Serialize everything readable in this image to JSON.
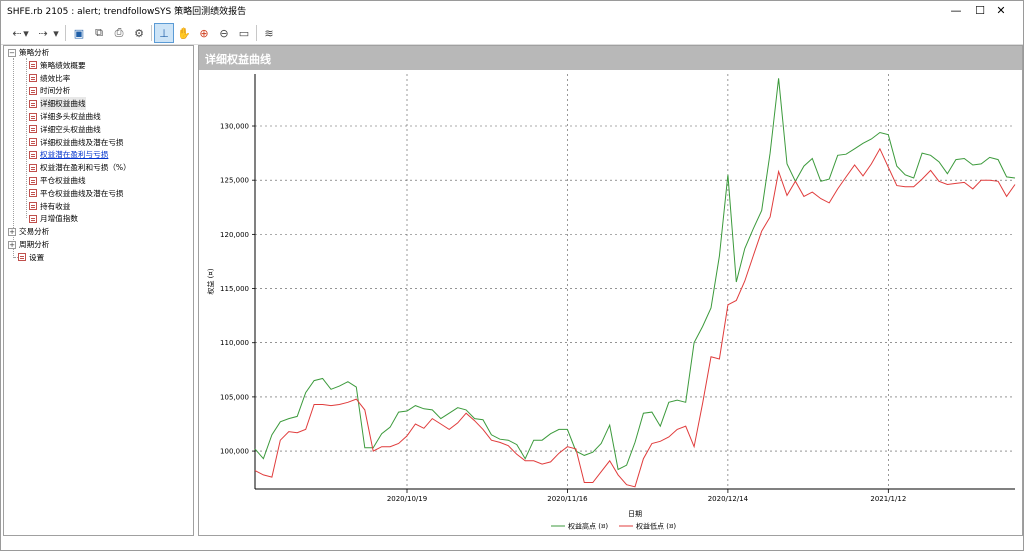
{
  "window": {
    "title": "SHFE.rb 2105 : alert; trendfollowSYS 策略回测绩效报告",
    "minimize": "—",
    "maximize": "☐",
    "close": "✕"
  },
  "toolbar": {
    "items": [
      {
        "name": "back-icon",
        "glyph": "⇠"
      },
      {
        "name": "dropdown-icon",
        "glyph": "▾"
      },
      {
        "name": "forward-icon",
        "glyph": "⇢"
      },
      {
        "name": "dropdown-icon",
        "glyph": "▾"
      },
      {
        "name": "save-icon",
        "glyph": "▣"
      },
      {
        "name": "copy-icon",
        "glyph": "⧉"
      },
      {
        "name": "print-icon",
        "glyph": "⎙"
      },
      {
        "name": "settings-icon",
        "glyph": "⚙"
      },
      {
        "name": "crosshair-icon",
        "glyph": "⊥"
      },
      {
        "name": "pan-hand-icon",
        "glyph": "✋"
      },
      {
        "name": "zoom-in-icon",
        "glyph": "⊕"
      },
      {
        "name": "zoom-out-icon",
        "glyph": "⊖"
      },
      {
        "name": "zoom-fit-icon",
        "glyph": "▭"
      },
      {
        "name": "chart-wizard-icon",
        "glyph": "≋"
      }
    ]
  },
  "sidebar": {
    "groups": [
      {
        "label": "策略分析",
        "expander": "−",
        "items": [
          {
            "label": "策略绩效概要"
          },
          {
            "label": "绩效比率"
          },
          {
            "label": "时间分析"
          },
          {
            "label": "详细权益曲线",
            "selected": true
          },
          {
            "label": "详细多头权益曲线"
          },
          {
            "label": "详细空头权益曲线"
          },
          {
            "label": "详细权益曲线及潜在亏损"
          },
          {
            "label": "权益潜在盈利与亏损",
            "link": true
          },
          {
            "label": "权益潜在盈利和亏损（%）"
          },
          {
            "label": "平仓权益曲线"
          },
          {
            "label": "平仓权益曲线及潜在亏损"
          },
          {
            "label": "持有收益"
          },
          {
            "label": "月增值指数"
          }
        ]
      },
      {
        "label": "交易分析",
        "expander": "+",
        "items": []
      },
      {
        "label": "周期分析",
        "expander": "+",
        "items": []
      }
    ],
    "extra": {
      "label": "设置"
    }
  },
  "panel": {
    "title": "详细权益曲线"
  },
  "chart_data": {
    "type": "line",
    "title": "",
    "xlabel": "日期",
    "ylabel": "权益 (¤)",
    "ylim": [
      96500,
      134800
    ],
    "yticks": [
      100000,
      105000,
      110000,
      115000,
      120000,
      125000,
      130000
    ],
    "ytick_labels": [
      "100,000",
      "105,000",
      "110,000",
      "115,000",
      "120,000",
      "125,000",
      "130,000"
    ],
    "xticks": [
      {
        "index": 18,
        "label": "2020/10/19"
      },
      {
        "index": 37,
        "label": "2020/11/16"
      },
      {
        "index": 56,
        "label": "2020/12/14"
      },
      {
        "index": 75,
        "label": "2021/1/12"
      }
    ],
    "legend_position": "bottom",
    "grid": true,
    "series": [
      {
        "name": "权益高点 (¤)",
        "color": "#3c9a3c",
        "values": [
          100200,
          99300,
          101500,
          102700,
          103000,
          103200,
          105400,
          106500,
          106700,
          105700,
          106000,
          106400,
          105900,
          100300,
          100300,
          101600,
          102200,
          103600,
          103700,
          104200,
          103900,
          103800,
          103000,
          103500,
          104000,
          103800,
          103000,
          102900,
          101500,
          101100,
          101000,
          100600,
          99300,
          101000,
          101000,
          101600,
          102000,
          102000,
          100000,
          99600,
          99900,
          100700,
          102400,
          98300,
          98700,
          100800,
          103500,
          103600,
          102300,
          104500,
          104700,
          104500,
          110000,
          111500,
          113200,
          118000,
          125500,
          115600,
          118700,
          120500,
          122200,
          127500,
          134400,
          126500,
          124900,
          126300,
          127000,
          124900,
          125100,
          127300,
          127400,
          127900,
          128400,
          128800,
          129400,
          129200,
          126300,
          125500,
          125200,
          127500,
          127300,
          126700,
          125600,
          126900,
          127000,
          126400,
          126500,
          127100,
          126900,
          125300,
          125200
        ]
      },
      {
        "name": "权益低点 (¤)",
        "color": "#e03c3c",
        "values": [
          98200,
          97800,
          97600,
          101000,
          101800,
          101700,
          102000,
          104300,
          104300,
          104200,
          104300,
          104500,
          104800,
          103800,
          100000,
          100400,
          100400,
          100700,
          101400,
          102500,
          102100,
          103000,
          102500,
          102000,
          102600,
          103500,
          102800,
          102000,
          101000,
          100800,
          100500,
          99700,
          99100,
          99100,
          98800,
          99000,
          99800,
          100400,
          100200,
          97100,
          97100,
          98100,
          99100,
          97800,
          96900,
          96700,
          99300,
          100700,
          100900,
          101300,
          102000,
          102300,
          100400,
          104400,
          108700,
          108500,
          113500,
          113900,
          115700,
          118000,
          120300,
          121600,
          125800,
          123600,
          124900,
          123500,
          123900,
          123300,
          122900,
          124200,
          125300,
          126400,
          125400,
          126500,
          127900,
          126200,
          124500,
          124400,
          124400,
          125100,
          125900,
          124900,
          124600,
          124700,
          124800,
          124200,
          125000,
          125000,
          124900,
          123500,
          124600
        ]
      }
    ]
  }
}
